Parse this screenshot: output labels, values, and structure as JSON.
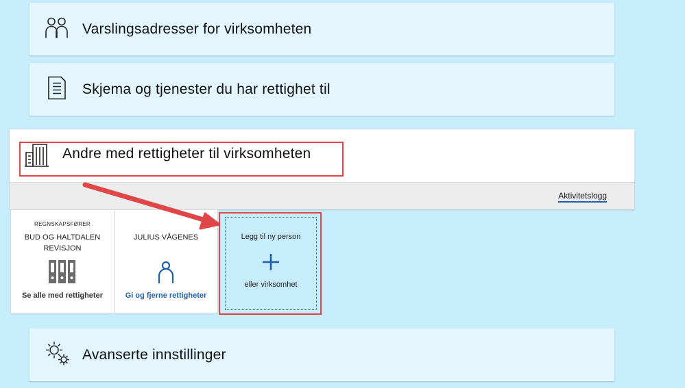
{
  "sections": {
    "notify": {
      "title": "Varslingsadresser for virksomheten",
      "icon": "people-icon"
    },
    "forms": {
      "title": "Skjema og tjenester du har rettighet til",
      "icon": "document-icon"
    },
    "others": {
      "title": "Andre med rettigheter til virksomheten",
      "icon": "building-icon",
      "activity_link": "Aktivitetslogg",
      "cards": {
        "accountant": {
          "role": "REGNSKAPSFØRER",
          "name_line1": "BUD OG HALTDALEN",
          "name_line2": "REVISJON",
          "icon": "binders-icon",
          "action": "Se alle med rettigheter"
        },
        "person": {
          "name": "JULIUS VÅGENES",
          "icon": "person-icon",
          "action": "Gi og fjerne rettigheter"
        },
        "add": {
          "line1": "Legg til ny person",
          "icon": "plus-icon",
          "line2": "eller virksomhet"
        }
      }
    },
    "advanced": {
      "title": "Avanserte innstillinger",
      "icon": "gears-icon"
    }
  },
  "colors": {
    "page_background": "#c7ecfb",
    "panel_background": "#e3f6fd",
    "link_blue": "#1f5fa8",
    "annotation_red": "#e04548"
  }
}
